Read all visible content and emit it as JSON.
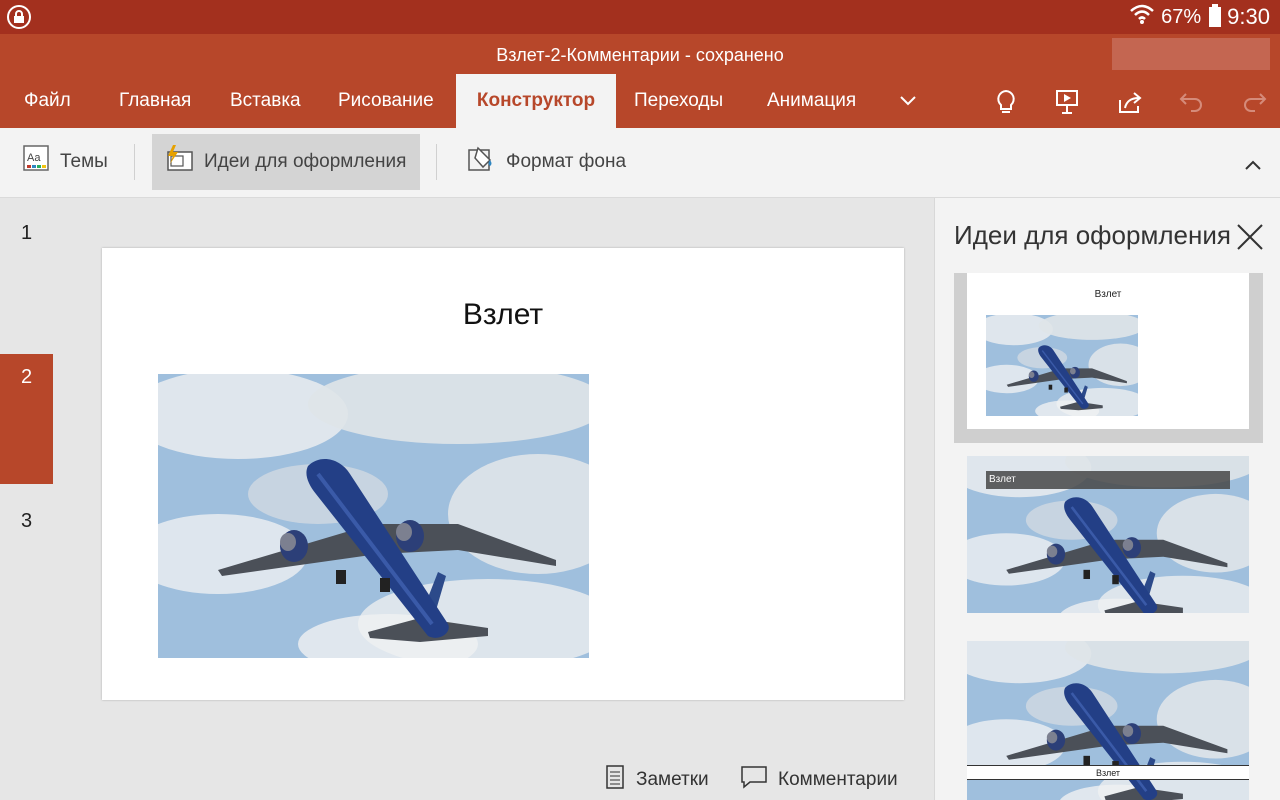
{
  "status_bar": {
    "battery": "67%",
    "time": "9:30"
  },
  "title_bar": {
    "document_title": "Взлет-2-Комментарии - сохранено"
  },
  "tabs": [
    {
      "label": "Файл"
    },
    {
      "label": "Главная"
    },
    {
      "label": "Вставка"
    },
    {
      "label": "Рисование"
    },
    {
      "label": "Конструктор",
      "active": true
    },
    {
      "label": "Переходы"
    },
    {
      "label": "Анимация"
    }
  ],
  "title_icons": [
    "tell-me-lightbulb-icon",
    "present-icon",
    "share-icon",
    "undo-icon",
    "redo-icon"
  ],
  "toolbar": {
    "themes": "Темы",
    "design_ideas": "Идеи для оформления",
    "format_background": "Формат фона"
  },
  "thumbnails": [
    "1",
    "2",
    "3"
  ],
  "active_slide": 2,
  "slide": {
    "title": "Взлет"
  },
  "bottom": {
    "notes": "Заметки",
    "comments": "Комментарии"
  },
  "design_pane": {
    "title": "Идеи для оформления",
    "idea1_title": "Взлет",
    "idea2_title": "Взлет",
    "idea3_title": "Взлет"
  },
  "colors": {
    "accent": "#b7472a",
    "status_bar": "#a3301e",
    "ribbon_bg": "#f3f3f3"
  }
}
